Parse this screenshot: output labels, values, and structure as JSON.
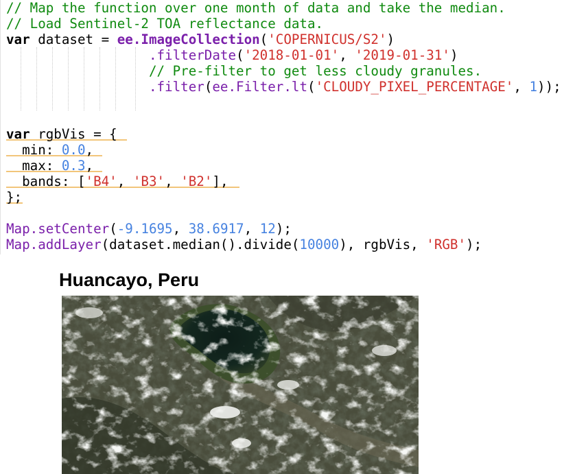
{
  "editor": {
    "lines": [
      [
        {
          "t": "comment",
          "v": "// Map the function over one month of data and take the median."
        }
      ],
      [
        {
          "t": "comment",
          "v": "// Load Sentinel-2 TOA reflectance data."
        }
      ],
      [
        {
          "t": "kw",
          "v": "var"
        },
        {
          "t": "plain",
          "v": " dataset = "
        },
        {
          "t": "ee",
          "v": "ee.ImageCollection"
        },
        {
          "t": "plain",
          "v": "("
        },
        {
          "t": "str",
          "v": "'COPERNICUS/S2'"
        },
        {
          "t": "plain",
          "v": ")"
        }
      ],
      [
        {
          "t": "plain",
          "v": "                  "
        },
        {
          "t": "fn",
          "v": ".filterDate"
        },
        {
          "t": "plain",
          "v": "("
        },
        {
          "t": "str",
          "v": "'2018-01-01'"
        },
        {
          "t": "plain",
          "v": ", "
        },
        {
          "t": "str",
          "v": "'2019-01-31'"
        },
        {
          "t": "plain",
          "v": ")"
        }
      ],
      [
        {
          "t": "plain",
          "v": "                  "
        },
        {
          "t": "comment",
          "v": "// Pre-filter to get less cloudy granules."
        }
      ],
      [
        {
          "t": "plain",
          "v": "                  "
        },
        {
          "t": "fn",
          "v": ".filter"
        },
        {
          "t": "plain",
          "v": "("
        },
        {
          "t": "fn",
          "v": "ee.Filter.lt"
        },
        {
          "t": "plain",
          "v": "("
        },
        {
          "t": "str",
          "v": "'CLOUDY_PIXEL_PERCENTAGE'"
        },
        {
          "t": "plain",
          "v": ", "
        },
        {
          "t": "num",
          "v": "1"
        },
        {
          "t": "plain",
          "v": "));"
        }
      ],
      [],
      [],
      [
        {
          "t": "kw",
          "v": "var"
        },
        {
          "t": "plain",
          "v": " rgbVis = {"
        }
      ],
      [
        {
          "t": "plain",
          "v": "  min: "
        },
        {
          "t": "num",
          "v": "0.0"
        },
        {
          "t": "plain",
          "v": ","
        }
      ],
      [
        {
          "t": "plain",
          "v": "  max: "
        },
        {
          "t": "num",
          "v": "0.3"
        },
        {
          "t": "plain",
          "v": ","
        }
      ],
      [
        {
          "t": "plain",
          "v": "  bands: ["
        },
        {
          "t": "str",
          "v": "'B4'"
        },
        {
          "t": "plain",
          "v": ", "
        },
        {
          "t": "str",
          "v": "'B3'"
        },
        {
          "t": "plain",
          "v": ", "
        },
        {
          "t": "str",
          "v": "'B2'"
        },
        {
          "t": "plain",
          "v": "],"
        }
      ],
      [
        {
          "t": "plain",
          "v": "};"
        }
      ],
      [],
      [
        {
          "t": "fn",
          "v": "Map.setCenter"
        },
        {
          "t": "plain",
          "v": "("
        },
        {
          "t": "num",
          "v": "-9.1695"
        },
        {
          "t": "plain",
          "v": ", "
        },
        {
          "t": "num",
          "v": "38.6917"
        },
        {
          "t": "plain",
          "v": ", "
        },
        {
          "t": "num",
          "v": "12"
        },
        {
          "t": "plain",
          "v": ");"
        }
      ],
      [
        {
          "t": "fn",
          "v": "Map.addLayer"
        },
        {
          "t": "plain",
          "v": "(dataset.median().divide("
        },
        {
          "t": "num",
          "v": "10000"
        },
        {
          "t": "plain",
          "v": "), rgbVis, "
        },
        {
          "t": "str",
          "v": "'RGB'"
        },
        {
          "t": "plain",
          "v": ");"
        }
      ]
    ],
    "colors": {
      "comment": "#0f8a0f",
      "kw": "#000000",
      "ee": "#7a1faa",
      "fn": "#7a1faa",
      "str": "#d0312d",
      "num": "#4682e0",
      "plain": "#000000"
    }
  },
  "output": {
    "title": "Huancayo, Peru",
    "image": {
      "kind": "satellite-rgb-composite",
      "colors": {
        "terrain": "#4a4d3c",
        "lake": "#13271f",
        "lake_shore": "#3d4f2c",
        "cloud": "#e8e9e6",
        "valley": "#6d6a55"
      }
    }
  }
}
